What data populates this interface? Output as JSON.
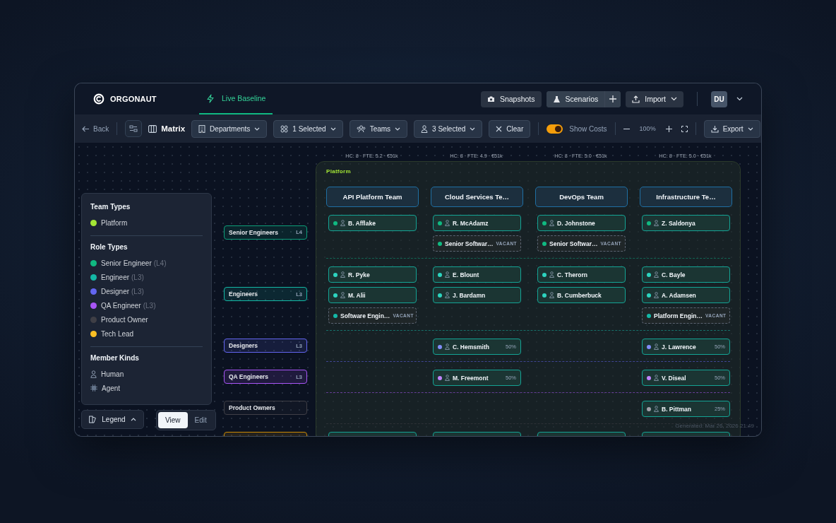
{
  "header": {
    "logo": "ORGONAUT",
    "tabs": [
      {
        "label": "Live Baseline",
        "selected": true
      }
    ],
    "snapshots": "Snapshots",
    "scenarios": "Scenarios",
    "import": "Import",
    "user": "DU"
  },
  "toolbar": {
    "back": "Back",
    "view": "Matrix",
    "filters": [
      {
        "label": "Departments",
        "kind": "building"
      },
      {
        "label": "1 Selected",
        "kind": "grid"
      },
      {
        "label": "Teams",
        "kind": "teams"
      },
      {
        "label": "3 Selected",
        "kind": "person"
      }
    ],
    "clear": "Clear",
    "show_costs": {
      "label": "Show Costs",
      "on": true
    },
    "zoom": "100%",
    "export": "Export"
  },
  "matrix": {
    "group": {
      "name": "Platform",
      "color": "#a3e635"
    },
    "teams": [
      {
        "name": "API Platform Team",
        "stats": "HC: 8 · FTE: 5.2 · €51k"
      },
      {
        "name": "Cloud Services Te…",
        "stats": "HC: 8 · FTE: 4.9 · €51k"
      },
      {
        "name": "DevOps Team",
        "stats": "HC: 8 · FTE: 5.0 · €51k"
      },
      {
        "name": "Infrastructure Te…",
        "stats": "HC: 8 · FTE: 5.0 · €51k"
      }
    ],
    "rows": [
      {
        "label": "Senior Engineers",
        "grade": "L4",
        "color": "#0d9f7a",
        "cells": [
          [
            {
              "name": "B. Afflake",
              "kind": "human",
              "color": "#10b981"
            }
          ],
          [
            {
              "name": "R. McAdamz",
              "kind": "human",
              "color": "#10b981"
            },
            {
              "name": "Senior Softwar…",
              "kind": "vacant",
              "color": "#10b981",
              "tag": "VACANT"
            }
          ],
          [
            {
              "name": "D. Johnstone",
              "kind": "human",
              "color": "#10b981"
            },
            {
              "name": "Senior Softwar…",
              "kind": "vacant",
              "color": "#10b981",
              "tag": "VACANT"
            }
          ],
          [
            {
              "name": "Z. Saldonya",
              "kind": "human",
              "color": "#10b981"
            }
          ]
        ]
      },
      {
        "label": "Engineers",
        "grade": "L3",
        "color": "#14b8a6",
        "cells": [
          [
            {
              "name": "R. Pyke",
              "kind": "human",
              "color": "#2dd4bf"
            },
            {
              "name": "M. Alii",
              "kind": "human",
              "color": "#2dd4bf"
            },
            {
              "name": "Software Engin…",
              "kind": "vacant",
              "color": "#14b8a6",
              "tag": "VACANT"
            }
          ],
          [
            {
              "name": "E. Blount",
              "kind": "human",
              "color": "#2dd4bf"
            },
            {
              "name": "J. Bardamn",
              "kind": "human",
              "color": "#2dd4bf"
            }
          ],
          [
            {
              "name": "C. Therorn",
              "kind": "human",
              "color": "#2dd4bf"
            },
            {
              "name": "B. Cumberbuck",
              "kind": "human",
              "color": "#2dd4bf"
            }
          ],
          [
            {
              "name": "C. Bayle",
              "kind": "human",
              "color": "#2dd4bf"
            },
            {
              "name": "A. Adamsen",
              "kind": "human",
              "color": "#2dd4bf"
            },
            {
              "name": "Platform Engin…",
              "kind": "vacant",
              "color": "#14b8a6",
              "tag": "VACANT"
            }
          ]
        ]
      },
      {
        "label": "Designers",
        "grade": "L3",
        "color": "#6366f1",
        "cells": [
          [],
          [
            {
              "name": "C. Hemsmith",
              "kind": "human",
              "color": "#818cf8",
              "share": "50%"
            }
          ],
          [],
          [
            {
              "name": "J. Lawrence",
              "kind": "human",
              "color": "#818cf8",
              "share": "50%"
            }
          ]
        ]
      },
      {
        "label": "QA Engineers",
        "grade": "L3",
        "color": "#a855f7",
        "cells": [
          [],
          [
            {
              "name": "M. Freemont",
              "kind": "human",
              "color": "#c084fc",
              "share": "50%"
            }
          ],
          [],
          [
            {
              "name": "V. Diseal",
              "kind": "human",
              "color": "#c084fc",
              "share": "50%"
            }
          ]
        ]
      },
      {
        "label": "Product Owners",
        "color": "#3f3f46",
        "cells": [
          [],
          [],
          [],
          [
            {
              "name": "B. Pittman",
              "kind": "human",
              "color": "#a1a1aa",
              "share": "25%"
            }
          ]
        ]
      },
      {
        "color": "#ca8a04",
        "cells": [
          [
            {
              "kind": "partial"
            }
          ],
          [
            {
              "kind": "partial"
            }
          ],
          [
            {
              "kind": "partial"
            }
          ],
          [
            {
              "kind": "partial"
            }
          ]
        ]
      }
    ]
  },
  "legend": {
    "sections": [
      {
        "title": "Team Types",
        "items": [
          {
            "label": "Platform",
            "kind": "dot",
            "color": "#a3e635"
          }
        ]
      },
      {
        "title": "Role Types",
        "items": [
          {
            "label": "Senior Engineer",
            "grade": "(L4)",
            "kind": "dot",
            "color": "#10b981"
          },
          {
            "label": "Engineer",
            "grade": "(L3)",
            "kind": "dot",
            "color": "#14b8a6"
          },
          {
            "label": "Designer",
            "grade": "(L3)",
            "kind": "dot",
            "color": "#6366f1"
          },
          {
            "label": "QA Engineer",
            "grade": "(L3)",
            "kind": "dot",
            "color": "#a855f7"
          },
          {
            "label": "Product Owner",
            "kind": "dot",
            "color": "#3f3f46"
          },
          {
            "label": "Tech Lead",
            "kind": "dot",
            "color": "#fbbf24"
          }
        ]
      },
      {
        "title": "Member Kinds",
        "items": [
          {
            "label": "Human",
            "kind": "human"
          },
          {
            "label": "Agent",
            "kind": "agent"
          }
        ]
      }
    ],
    "button": "Legend",
    "modes": [
      {
        "label": "View",
        "selected": true
      },
      {
        "label": "Edit",
        "selected": false
      }
    ]
  },
  "generated": "Generated: Mar 26, 2026 21:49"
}
